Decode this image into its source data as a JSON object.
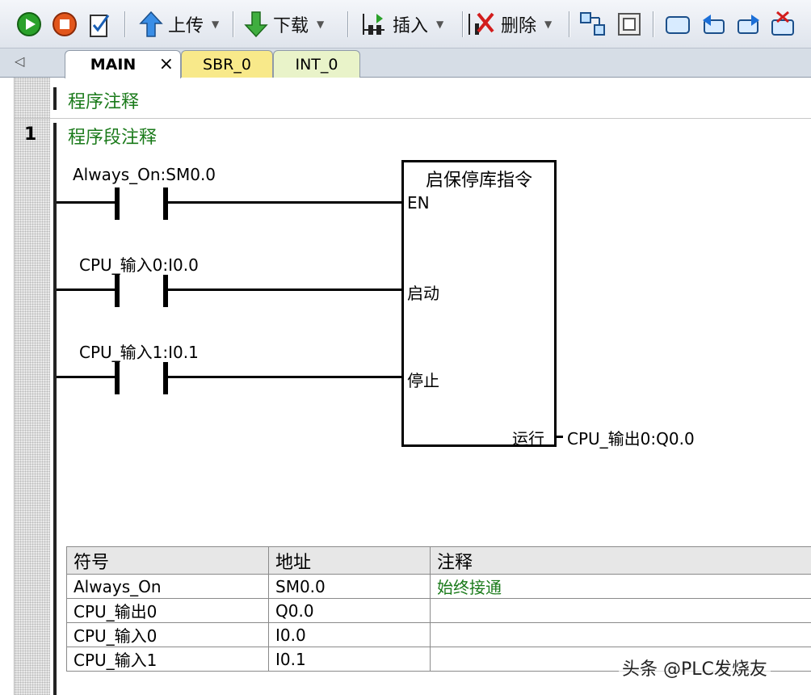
{
  "toolbar": {
    "upload_label": "上传",
    "download_label": "下载",
    "insert_label": "插入",
    "delete_label": "删除"
  },
  "tabs": [
    {
      "label": "MAIN",
      "close": "×"
    },
    {
      "label": "SBR_0"
    },
    {
      "label": "INT_0"
    }
  ],
  "editor": {
    "program_comment": "程序注释",
    "network_number": "1",
    "network_comment": "程序段注释"
  },
  "ladder": {
    "contacts": [
      {
        "label": "Always_On:SM0.0"
      },
      {
        "label": "CPU_输入0:I0.0"
      },
      {
        "label": "CPU_输入1:I0.1"
      }
    ],
    "block": {
      "title": "启保停库指令",
      "inputs": [
        "EN",
        "启动",
        "停止"
      ],
      "output": "运行"
    },
    "output_label": "CPU_输出0:Q0.0"
  },
  "symbol_table": {
    "headers": [
      "符号",
      "地址",
      "注释"
    ],
    "rows": [
      {
        "symbol": "Always_On",
        "address": "SM0.0",
        "comment": "始终接通"
      },
      {
        "symbol": "CPU_输出0",
        "address": "Q0.0",
        "comment": ""
      },
      {
        "symbol": "CPU_输入0",
        "address": "I0.0",
        "comment": ""
      },
      {
        "symbol": "CPU_输入1",
        "address": "I0.1",
        "comment": ""
      }
    ]
  },
  "watermark": "头条 @PLC发烧友",
  "colors": {
    "comment_green": "#1a7a1a",
    "sbr_tab": "#f8e98a",
    "int_tab": "#e9f3c9"
  }
}
